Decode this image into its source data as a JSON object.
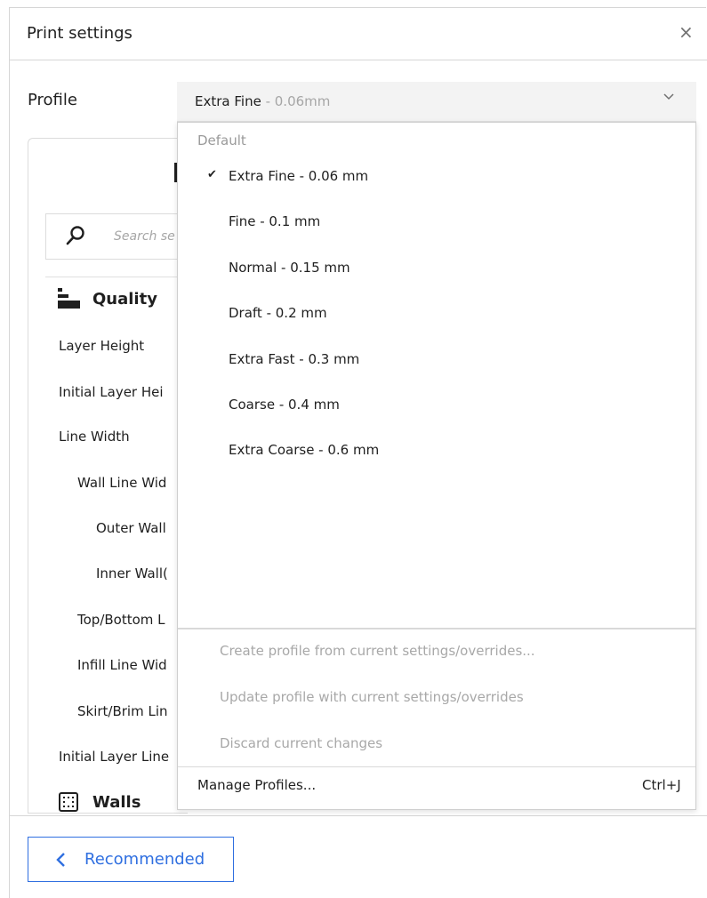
{
  "dialog": {
    "title": "Print settings",
    "close_label": "×"
  },
  "profile": {
    "label": "Profile",
    "selected_name": "Extra Fine",
    "selected_detail": " - 0.06mm"
  },
  "search": {
    "placeholder": "Search se"
  },
  "sidebar": {
    "categories": [
      {
        "label": "Quality",
        "icon": "quality-icon"
      },
      {
        "label": "Walls",
        "icon": "walls-icon"
      }
    ],
    "settings": [
      "Layer Height",
      "Initial Layer Hei",
      "Line Width",
      "Wall Line Wid",
      "Outer Wall",
      "Inner Wall(",
      "Top/Bottom L",
      "Infill Line Wid",
      "Skirt/Brim Lin",
      "Initial Layer Line"
    ]
  },
  "dropdown": {
    "group_label": "Default",
    "items": [
      {
        "label": "Extra Fine - 0.06 mm",
        "checked": true
      },
      {
        "label": "Fine - 0.1 mm",
        "checked": false
      },
      {
        "label": "Normal - 0.15 mm",
        "checked": false
      },
      {
        "label": "Draft - 0.2 mm",
        "checked": false
      },
      {
        "label": "Extra Fast - 0.3 mm",
        "checked": false
      },
      {
        "label": "Coarse - 0.4 mm",
        "checked": false
      },
      {
        "label": "Extra Coarse - 0.6 mm",
        "checked": false
      }
    ],
    "check_mark": "✔",
    "actions": [
      "Create profile from current settings/overrides...",
      "Update profile with current settings/overrides",
      "Discard current changes"
    ],
    "manage": {
      "label": "Manage Profiles...",
      "shortcut": "Ctrl+J"
    }
  },
  "footer": {
    "recommended_label": "Recommended"
  },
  "colors": {
    "accent": "#2f6fe0",
    "disabled_text": "#a8a8a8",
    "text": "#1f1f1f"
  }
}
